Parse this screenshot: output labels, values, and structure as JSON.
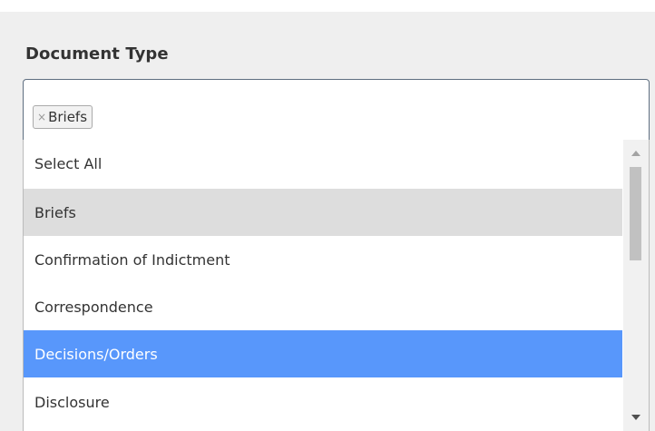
{
  "field": {
    "label": "Document Type"
  },
  "selected_chips": [
    {
      "label": "Briefs",
      "remove_symbol": "×"
    }
  ],
  "options": [
    {
      "label": "Select All",
      "state": "normal"
    },
    {
      "label": "Briefs",
      "state": "selected"
    },
    {
      "label": "Confirmation of Indictment",
      "state": "normal"
    },
    {
      "label": "Correspondence",
      "state": "normal"
    },
    {
      "label": "Decisions/Orders",
      "state": "highlighted"
    },
    {
      "label": "Disclosure",
      "state": "normal"
    }
  ],
  "icons": {
    "chip_remove": "close-icon",
    "scroll_up": "arrow-up-icon",
    "scroll_down": "arrow-down-icon"
  },
  "colors": {
    "highlight": "#5897fb",
    "selected": "#dddddd",
    "border": "#5e6e80"
  }
}
